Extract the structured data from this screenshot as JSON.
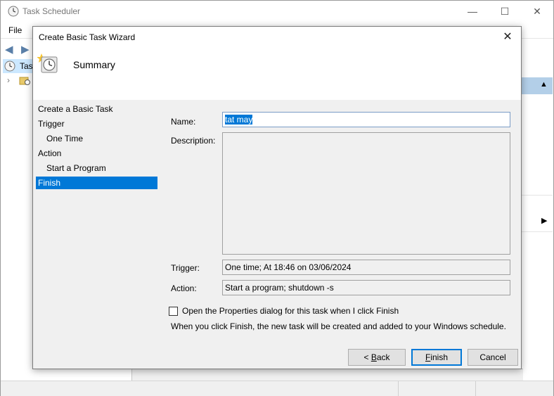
{
  "app": {
    "title": "Task Scheduler",
    "menu_file": "File",
    "tree_task_label": "Task",
    "window_controls": [
      "minimize-icon",
      "maximize-icon",
      "close-icon"
    ]
  },
  "dialog": {
    "title": "Create Basic Task Wizard",
    "header_title": "Summary",
    "steps": [
      {
        "label": "Create a Basic Task"
      },
      {
        "label": "Trigger"
      },
      {
        "label": "One Time"
      },
      {
        "label": "Action"
      },
      {
        "label": "Start a Program"
      },
      {
        "label": "Finish"
      }
    ],
    "name_label": "Name:",
    "name_value": "tat may",
    "description_label": "Description:",
    "description_value": "",
    "trigger_label": "Trigger:",
    "trigger_value": "One time; At 18:46 on 03/06/2024",
    "action_label": "Action:",
    "action_value": "Start a program; shutdown -s",
    "open_properties_label": "Open the Properties dialog for this task when I click Finish",
    "open_properties_checked": false,
    "info_text": "When you click Finish, the new task will be created and added to your Windows schedule.",
    "buttons": {
      "back_pre": "< ",
      "back_key": "B",
      "back_rest": "ack",
      "finish_key": "F",
      "finish_rest": "inish",
      "cancel": "Cancel"
    }
  },
  "colors": {
    "selection": "#0078d7",
    "dialog_bg": "#f0f0f0"
  }
}
